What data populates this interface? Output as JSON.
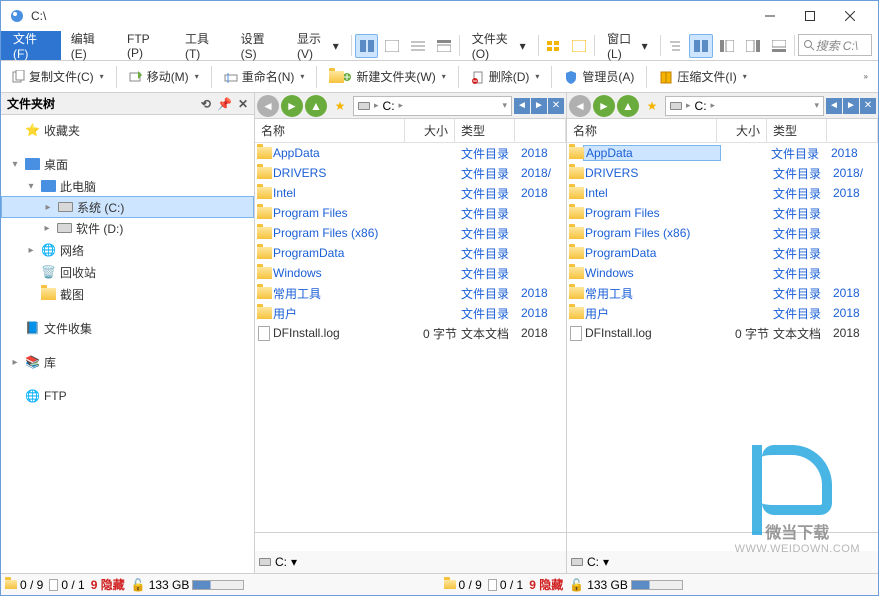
{
  "window": {
    "title": "C:\\"
  },
  "menubar": {
    "file": "文件(F)",
    "items": [
      "编辑(E)",
      "FTP (P)",
      "工具(T)",
      "设置(S)",
      "显示(V)"
    ],
    "dropdowns": [
      "文件夹(O)",
      "窗口(L)"
    ]
  },
  "search": {
    "placeholder": "搜索 C:\\"
  },
  "toolbar": {
    "copy": "复制文件(C)",
    "move": "移动(M)",
    "rename": "重命名(N)",
    "newfolder": "新建文件夹(W)",
    "delete": "删除(D)",
    "admin": "管理员(A)",
    "compress": "压缩文件(I)"
  },
  "tree": {
    "header": "文件夹树",
    "favorites": "收藏夹",
    "desktop": "桌面",
    "thispc": "此电脑",
    "drive_c": "系统 (C:)",
    "drive_d": "软件 (D:)",
    "network": "网络",
    "recycle": "回收站",
    "screenshot": "截图",
    "filecollect": "文件收集",
    "library": "库",
    "ftp": "FTP"
  },
  "pane": {
    "path_drive": "C:",
    "cols": {
      "name": "名称",
      "size": "大小",
      "type": "类型",
      "date": ""
    },
    "rows": [
      {
        "name": "AppData",
        "size": "",
        "type": "文件目录",
        "date": "2018",
        "kind": "folder"
      },
      {
        "name": "DRIVERS",
        "size": "",
        "type": "文件目录",
        "date": "2018/",
        "kind": "folder"
      },
      {
        "name": "Intel",
        "size": "",
        "type": "文件目录",
        "date": "2018",
        "kind": "folder"
      },
      {
        "name": "Program Files",
        "size": "",
        "type": "文件目录",
        "date": "",
        "kind": "folder"
      },
      {
        "name": "Program Files (x86)",
        "size": "",
        "type": "文件目录",
        "date": "",
        "kind": "folder"
      },
      {
        "name": "ProgramData",
        "size": "",
        "type": "文件目录",
        "date": "",
        "kind": "folder"
      },
      {
        "name": "Windows",
        "size": "",
        "type": "文件目录",
        "date": "",
        "kind": "folder"
      },
      {
        "name": "常用工具",
        "size": "",
        "type": "文件目录",
        "date": "2018",
        "kind": "folder"
      },
      {
        "name": "用户",
        "size": "",
        "type": "文件目录",
        "date": "2018",
        "kind": "folder"
      },
      {
        "name": "DFInstall.log",
        "size": "0 字节",
        "type": "文本文档",
        "date": "2018",
        "kind": "file"
      }
    ]
  },
  "status": {
    "folders": "0 / 9",
    "files": "0 / 1",
    "hidden": "9 隐藏",
    "disk": "133 GB"
  },
  "drivebar": {
    "drive": "C:"
  },
  "watermark": {
    "name": "微当下载",
    "url": "WWW.WEIDOWN.COM"
  }
}
